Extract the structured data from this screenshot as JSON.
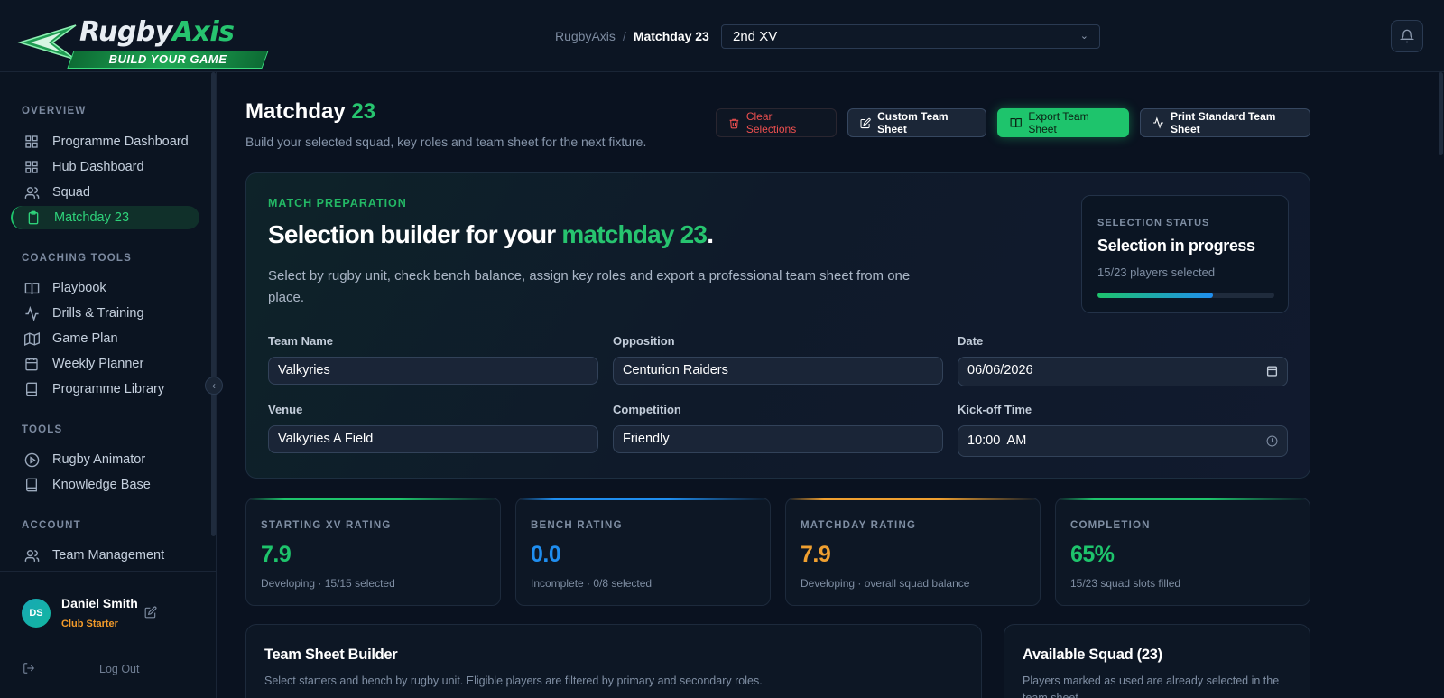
{
  "brand": {
    "name_part1": "Rugby",
    "name_part2": "Axis",
    "tagline": "BUILD YOUR GAME"
  },
  "header": {
    "breadcrumb_root": "RugbyAxis",
    "breadcrumb_sep": "/",
    "breadcrumb_current": "Matchday 23",
    "team_select_value": "2nd XV"
  },
  "sidebar": {
    "sections": {
      "overview": "OVERVIEW",
      "coaching": "COACHING TOOLS",
      "tools": "TOOLS",
      "account": "ACCOUNT"
    },
    "items": [
      {
        "label": "Programme Dashboard",
        "icon": "grid-icon"
      },
      {
        "label": "Hub Dashboard",
        "icon": "grid-icon"
      },
      {
        "label": "Squad",
        "icon": "users-icon"
      },
      {
        "label": "Matchday 23",
        "icon": "clipboard-icon"
      },
      {
        "label": "Playbook",
        "icon": "book-open-icon"
      },
      {
        "label": "Drills & Training",
        "icon": "activity-icon"
      },
      {
        "label": "Game Plan",
        "icon": "map-icon"
      },
      {
        "label": "Weekly Planner",
        "icon": "calendar-icon"
      },
      {
        "label": "Programme Library",
        "icon": "book-icon"
      },
      {
        "label": "Rugby Animator",
        "icon": "play-circle-icon"
      },
      {
        "label": "Knowledge Base",
        "icon": "book-icon"
      },
      {
        "label": "Team Management",
        "icon": "users-icon"
      }
    ],
    "user": {
      "initials": "DS",
      "name": "Daniel Smith",
      "plan": "Club Starter"
    },
    "logout_label": "Log Out"
  },
  "page": {
    "title_part1": "Matchday",
    "title_part2": "23",
    "subtitle": "Build your selected squad, key roles and team sheet for the next fixture."
  },
  "actions": {
    "clear": "Clear Selections",
    "custom": "Custom Team Sheet",
    "export": "Export Team Sheet",
    "print": "Print Standard Team Sheet"
  },
  "prep": {
    "eyebrow": "MATCH PREPARATION",
    "title_part1": "Selection builder for your",
    "title_accent": "matchday 23",
    "title_end": ".",
    "description": "Select by rugby unit, check bench balance, assign key roles and export a professional team sheet from one place.",
    "status": {
      "eyebrow": "SELECTION STATUS",
      "title": "Selection in progress",
      "count_text": "15/23 players selected",
      "progress_fraction": 0.652
    },
    "fields": {
      "team_name_label": "Team Name",
      "team_name_value": "Valkyries",
      "opposition_label": "Opposition",
      "opposition_value": "Centurion Raiders",
      "date_label": "Date",
      "date_value": "06/06/2026",
      "venue_label": "Venue",
      "venue_value": "Valkyries A Field",
      "competition_label": "Competition",
      "competition_value": "Friendly",
      "kickoff_label": "Kick-off Time",
      "kickoff_value": "10:00  AM"
    }
  },
  "ratings": [
    {
      "label": "STARTING XV RATING",
      "value": "7.9",
      "note": "Developing · 15/15 selected",
      "color": "#1ec46c"
    },
    {
      "label": "BENCH RATING",
      "value": "0.0",
      "note": "Incomplete · 0/8 selected",
      "color": "#1f8ef0"
    },
    {
      "label": "MATCHDAY RATING",
      "value": "7.9",
      "note": "Developing · overall squad balance",
      "color": "#f0a030"
    },
    {
      "label": "COMPLETION",
      "value": "65%",
      "note": "15/23 squad slots filled",
      "color": "#1ec46c"
    }
  ],
  "builder": {
    "title": "Team Sheet Builder",
    "subtitle": "Select starters and bench by rugby unit. Eligible players are filtered by primary and secondary roles."
  },
  "squad": {
    "title": "Available Squad (23)",
    "subtitle": "Players marked as used are already selected in the team sheet."
  },
  "colors": {
    "accent": "#27c46f",
    "danger": "#ec4f4f",
    "background": "#0a1220"
  }
}
